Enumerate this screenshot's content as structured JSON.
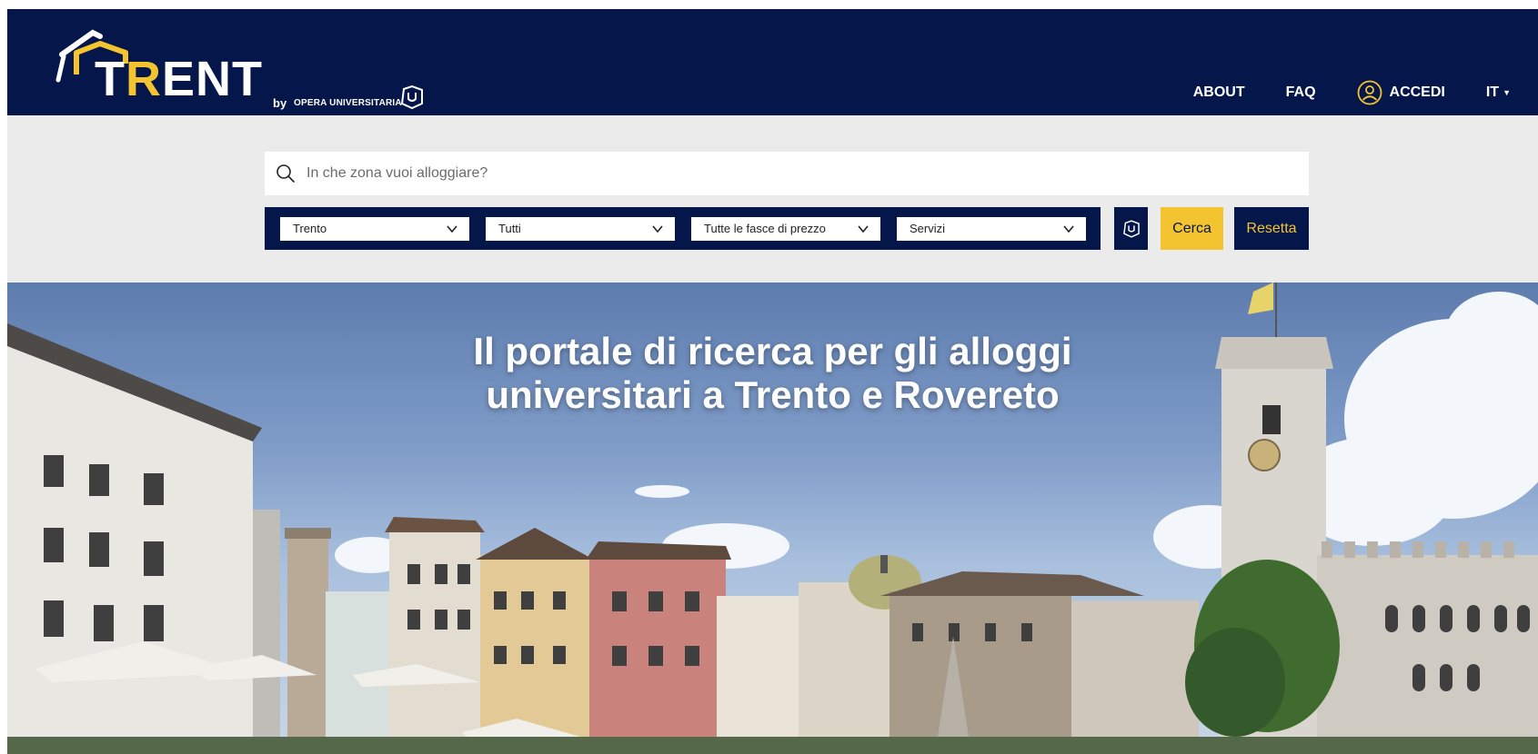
{
  "brand": {
    "logo_word_main": "T",
    "logo_word_accent": "R",
    "logo_word_rest": "ENT",
    "by": "by",
    "opera": "OPERA UNIVERSITARIA",
    "navy": "#05164a",
    "yellow": "#f4c430"
  },
  "nav": {
    "about": "ABOUT",
    "faq": "FAQ",
    "login": "ACCEDI",
    "lang": "IT"
  },
  "search": {
    "placeholder": "In che zona vuoi alloggiare?"
  },
  "filters": {
    "city": "Trento",
    "type": "Tutti",
    "price": "Tutte le fasce di prezzo",
    "services": "Servizi"
  },
  "buttons": {
    "search": "Cerca",
    "reset": "Resetta"
  },
  "hero": {
    "title_line1": "Il portale di ricerca per gli alloggi",
    "title_line2": "universitari a Trento e Rovereto"
  },
  "icons": {
    "search": "search-icon",
    "user": "user-circle-icon",
    "chevron": "chevron-down-icon",
    "opera": "opera-universitaria-icon"
  }
}
